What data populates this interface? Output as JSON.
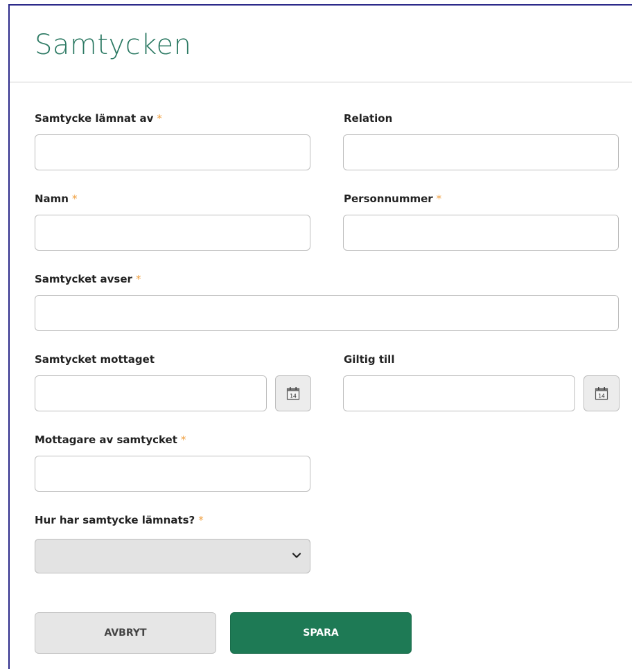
{
  "page": {
    "title": "Samtycken"
  },
  "form": {
    "required_marker": "*",
    "fields": {
      "given_by": {
        "label": "Samtycke lämnat av",
        "value": ""
      },
      "relation": {
        "label": "Relation",
        "value": ""
      },
      "name": {
        "label": "Namn",
        "value": ""
      },
      "personal_number": {
        "label": "Personnummer",
        "value": ""
      },
      "consent_concerns": {
        "label": "Samtycket avser",
        "value": ""
      },
      "received_date": {
        "label": "Samtycket mottaget",
        "value": "",
        "calendar_day": "14"
      },
      "valid_until": {
        "label": "Giltig till",
        "value": "",
        "calendar_day": "14"
      },
      "recipient": {
        "label": "Mottagare av samtycket",
        "value": ""
      },
      "how_given": {
        "label": "Hur har samtycke lämnats?",
        "selected": ""
      }
    }
  },
  "actions": {
    "cancel_label": "AVBRYT",
    "save_label": "SPARA"
  },
  "colors": {
    "title": "#2d7a64",
    "required_marker": "#f0a040",
    "save_button": "#1e7a55",
    "frame_border": "#2c2a8a"
  },
  "icons": {
    "calendar": "calendar-icon",
    "dropdown": "chevron-down-icon"
  }
}
